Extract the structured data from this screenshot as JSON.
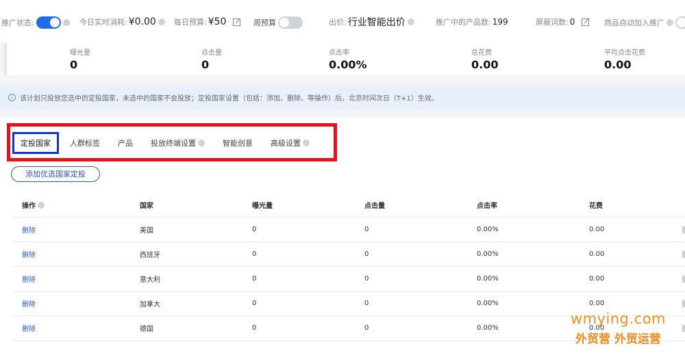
{
  "topbar": {
    "status_label": "推广状态:",
    "realtime_label": "今日实时消耗:",
    "realtime_value": "¥0.00",
    "budget_label": "每日预算:",
    "budget_value": "¥50",
    "weekly_label": "周预算",
    "bid_label": "出价:",
    "bid_value": "行业智能出价",
    "products_label": "推广中的产品数:",
    "products_value": "199",
    "blocked_label": "屏蔽词数:",
    "blocked_value": "0",
    "auto_add_label": "商品自动加入推广"
  },
  "stats": [
    {
      "label": "曝光量",
      "value": "0"
    },
    {
      "label": "点击量",
      "value": "0"
    },
    {
      "label": "点击率",
      "value": "0.00%"
    },
    {
      "label": "总花费",
      "value": "0.00"
    },
    {
      "label": "平均点击花费",
      "value": "0.00"
    }
  ],
  "notice": {
    "text": "该计划只投放您选中的定投国家，未选中的国家不会投放；定投国家设置（包括：添加、删除、等操作）后，北京时间次日（T+1）生效。"
  },
  "tabs": [
    {
      "label": "定投国家"
    },
    {
      "label": "人群标签"
    },
    {
      "label": "产品"
    },
    {
      "label": "投放终端设置"
    },
    {
      "label": "智能创意"
    },
    {
      "label": "高级设置"
    }
  ],
  "add_button": "添加优选国家定投",
  "table": {
    "headers": [
      "操作",
      "国家",
      "曝光量",
      "点击量",
      "点击率",
      "花费"
    ],
    "rows": [
      {
        "action": "删除",
        "country": "美国",
        "impressions": "0",
        "clicks": "0",
        "ctr": "0.00%",
        "cost": "0.00"
      },
      {
        "action": "删除",
        "country": "西班牙",
        "impressions": "0",
        "clicks": "0",
        "ctr": "0.00%",
        "cost": "0.00"
      },
      {
        "action": "删除",
        "country": "意大利",
        "impressions": "0",
        "clicks": "0",
        "ctr": "0.00%",
        "cost": "0.00"
      },
      {
        "action": "删除",
        "country": "加拿大",
        "impressions": "0",
        "clicks": "0",
        "ctr": "0.00%",
        "cost": "0.00"
      },
      {
        "action": "删除",
        "country": "德国",
        "impressions": "0",
        "clicks": "0",
        "ctr": "0.00%",
        "cost": "0.00"
      }
    ]
  },
  "watermark": {
    "line1": "wmying.com",
    "line2": "外贸营 外贸运营"
  },
  "colors": {
    "accent": "#1a6fe8",
    "link": "#2b59c3",
    "highlight_red": "#e8101c",
    "highlight_blue": "#1330d8",
    "watermark": "#f28c1b"
  }
}
